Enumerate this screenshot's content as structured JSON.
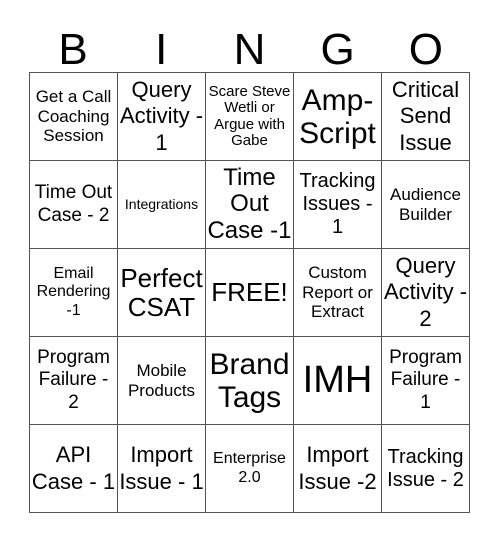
{
  "header": [
    "B",
    "I",
    "N",
    "G",
    "O"
  ],
  "cells": [
    "Get a Call Coaching Session",
    "Query Activity - 1",
    "Scare Steve Wetli or Argue with Gabe",
    "Amp-Script",
    "Critical Send Issue",
    "Time Out Case - 2",
    "Integrations",
    "Time Out Case -1",
    "Tracking Issues - 1",
    "Audience Builder",
    "Email Rendering -1",
    "Perfect CSAT",
    "FREE!",
    "Custom Report or Extract",
    "Query Activity - 2",
    "Program Failure - 2",
    "Mobile Products",
    "Brand Tags",
    "IMH",
    "Program Failure - 1",
    "API Case - 1",
    "Import Issue - 1",
    "Enterprise 2.0",
    "Import Issue -2",
    "Tracking Issue - 2"
  ]
}
